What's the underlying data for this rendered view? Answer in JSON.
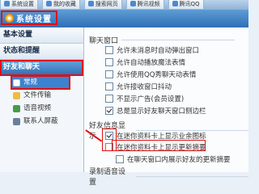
{
  "browser_tabs": [
    {
      "label": "系统设置"
    },
    {
      "label": "我的收藏"
    },
    {
      "label": "搜索网页"
    },
    {
      "label": "腾讯视频"
    },
    {
      "label": "腾讯QQ"
    }
  ],
  "window": {
    "title": "系统设置",
    "icon": "gear-icon"
  },
  "sidebar": {
    "categories": [
      {
        "label": "基本设置"
      },
      {
        "label": "状态和提醒"
      },
      {
        "label": "好友和聊天"
      }
    ],
    "sub_items": [
      {
        "label": "常规",
        "icon": "general-icon"
      },
      {
        "label": "文件传输",
        "icon": "folder-icon"
      },
      {
        "label": "语音视频",
        "icon": "voice-icon"
      },
      {
        "label": "联系人屏蔽",
        "icon": "contact-icon"
      }
    ]
  },
  "content": {
    "section_chat": "聊天窗口",
    "chat_options": [
      {
        "label": "允许未消息时自动弹出窗口",
        "checked": false
      },
      {
        "label": "允许自动播放魔法表情",
        "checked": false
      },
      {
        "label": "允许使用QQ秀聊天动表情",
        "checked": false
      },
      {
        "label": "允许接收窗口抖动",
        "checked": false
      },
      {
        "label": "不显示广告(会员设置)",
        "checked": false
      },
      {
        "label": "总是显示好友聊天窗口侧边栏",
        "checked": true
      }
    ],
    "section_friend": "好友信息显示",
    "friend_options": [
      {
        "label": "在迷你资料卡上显示业余图标",
        "checked": true
      },
      {
        "label": "在迷你资料卡上显示更新摘要",
        "checked": false
      },
      {
        "label": "在聊天窗口内展示好友的更新摘要",
        "checked": false
      }
    ],
    "section_other": "录制语音设置"
  },
  "colors": {
    "accent": "#2f6fb5",
    "highlight": "#e01010"
  }
}
